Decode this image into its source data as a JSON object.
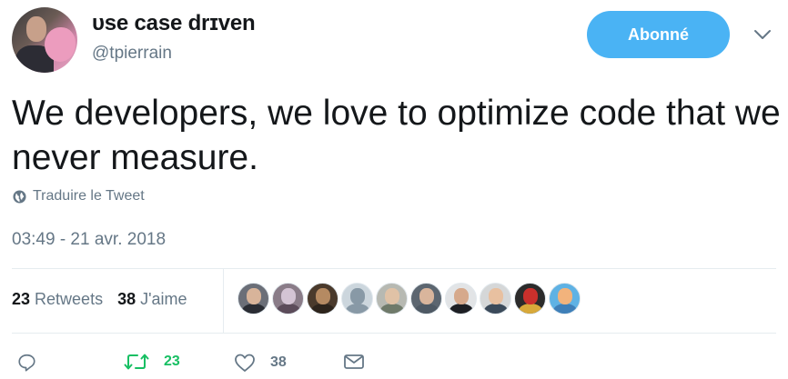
{
  "user": {
    "display_name": "ᴜse case drɪven",
    "handle": "@tpierrain"
  },
  "follow_button": {
    "label": "Abonné"
  },
  "tweet": {
    "text": "We developers, we love to optimize code that we never measure.",
    "translate_label": "Traduire le Tweet",
    "timestamp": "03:49 - 21 avr. 2018"
  },
  "stats": {
    "retweets_count": "23",
    "retweets_label": "Retweets",
    "likes_count": "38",
    "likes_label": "J'aime"
  },
  "likers": [
    {
      "icon": "avatar-liker-1",
      "bg": "#6b6f78",
      "face": "#d8b49a",
      "body": "#2a2d34"
    },
    {
      "icon": "avatar-liker-2",
      "bg": "#8a7c88",
      "face": "#d4c4d4",
      "body": "#5c4c5a"
    },
    {
      "icon": "avatar-liker-3",
      "bg": "#4a3a2c",
      "face": "#b58a62",
      "body": "#2d241c"
    },
    {
      "icon": "avatar-liker-4-default",
      "bg": "#ccd6dd",
      "face": "#8899a6",
      "body": "#8899a6"
    },
    {
      "icon": "avatar-liker-5",
      "bg": "#b7b9b2",
      "face": "#e0c2a6",
      "body": "#6f7a6a"
    },
    {
      "icon": "avatar-liker-6",
      "bg": "#5c6670",
      "face": "#d9b59c",
      "body": "#4e5964"
    },
    {
      "icon": "avatar-liker-7",
      "bg": "#e2e4e6",
      "face": "#d6a98c",
      "body": "#1d1f24"
    },
    {
      "icon": "avatar-liker-8",
      "bg": "#d5d7d8",
      "face": "#e8c0a0",
      "body": "#3b4a5a"
    },
    {
      "icon": "avatar-liker-9",
      "bg": "#2b2b2b",
      "face": "#c9302c",
      "body": "#d8a93a"
    },
    {
      "icon": "avatar-liker-10",
      "bg": "#5fb2e4",
      "face": "#f2b37c",
      "body": "#3f7fb8"
    }
  ],
  "actions": {
    "reply_icon": "reply-icon",
    "retweet_icon": "retweet-icon",
    "retweet_count": "23",
    "like_icon": "heart-icon",
    "like_count": "38",
    "dm_icon": "envelope-icon"
  },
  "colors": {
    "accent": "#4ab3f4",
    "retweet_green": "#17bf63",
    "secondary_text": "#657786"
  }
}
